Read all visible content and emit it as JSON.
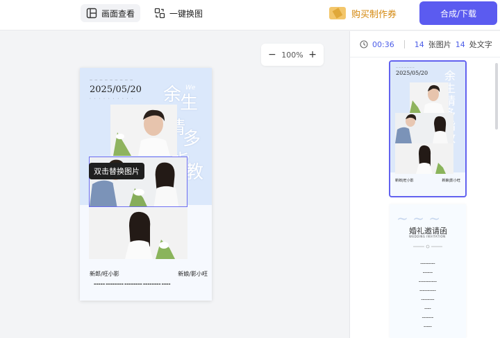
{
  "toolbar": {
    "canvas_view_label": "画面查看",
    "swap_all_label": "一键换图",
    "buy_label": "购买制作券",
    "download_label": "合成/下载"
  },
  "zoom": {
    "minus": "−",
    "level": "100%",
    "plus": "+"
  },
  "poster": {
    "date": "2025/05/20",
    "headline_chars": [
      "余",
      "生",
      "请",
      "多",
      "指",
      "教"
    ],
    "we_text": "We",
    "groom_name": "新郎/旺小影",
    "bride_name": "新娘/影小旺",
    "tooltip": "双击替换图片"
  },
  "panel": {
    "timer": "00:36",
    "image_count": "14",
    "image_label": "张图片",
    "text_count": "14",
    "text_label": "处文字"
  },
  "thumb1": {
    "date": "2025/05/20",
    "headline": "余生请多指教",
    "groom_name": "新郎|旺小影",
    "bride_name": "新娘|影小旺"
  },
  "thumb2": {
    "title": "婚礼邀请函",
    "subtitle": "WEDDING INVITATION"
  },
  "colors": {
    "accent": "#5b5bf0",
    "buy": "#d4870c",
    "poster_blue": "#dbe8fb"
  }
}
